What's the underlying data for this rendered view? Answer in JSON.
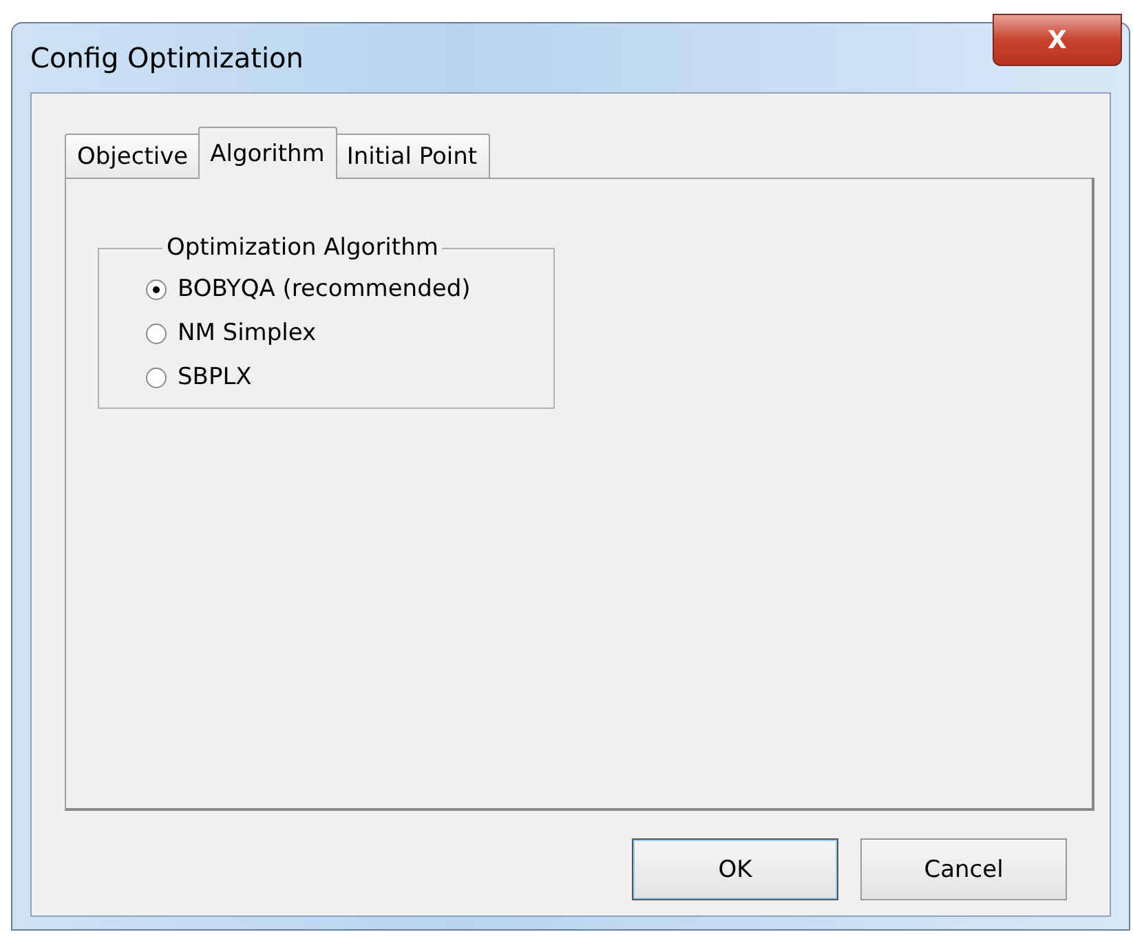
{
  "window": {
    "title": "Config Optimization",
    "close": "X"
  },
  "tabs": [
    {
      "label": "Objective",
      "selected": false
    },
    {
      "label": "Algorithm",
      "selected": true
    },
    {
      "label": "Initial Point",
      "selected": false
    }
  ],
  "group": {
    "title": "Optimization Algorithm",
    "options": [
      {
        "label": "BOBYQA (recommended)",
        "selected": true
      },
      {
        "label": "NM Simplex",
        "selected": false
      },
      {
        "label": "SBPLX",
        "selected": false
      }
    ]
  },
  "buttons": [
    {
      "label": "OK",
      "default": true
    },
    {
      "label": "Cancel",
      "default": false
    }
  ]
}
